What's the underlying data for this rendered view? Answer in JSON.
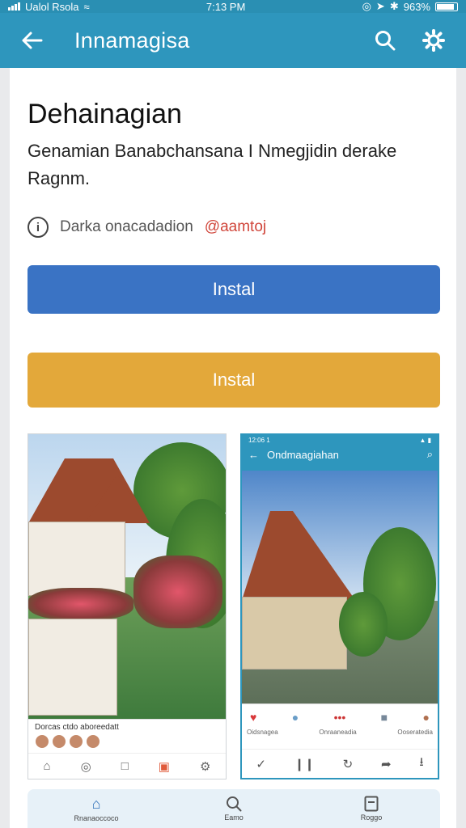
{
  "status_bar": {
    "carrier": "Ualol Rsola",
    "time": "7:13 PM",
    "battery": "963%"
  },
  "app_bar": {
    "title": "Innamagisa"
  },
  "content": {
    "heading": "Dehainagian",
    "description": "Genamian Banabchansana I Nmegjidin derake Ragnm.",
    "info_text": "Darka onacadadion",
    "info_link": "@aamtoj",
    "primary_button": "Instal",
    "secondary_button": "Instal"
  },
  "screenshot_left": {
    "caption": "Dorcas ctdo aboreedatt"
  },
  "screenshot_right": {
    "status_time": "12:06 1",
    "title": "Ondmaagiahan",
    "social_labels": [
      "Oidsnagea",
      "Onraaneadia",
      "Ooseratedia"
    ]
  },
  "bottom_nav": {
    "items": [
      {
        "label": "Rnanaoccoco",
        "icon": "home-icon"
      },
      {
        "label": "Eamo",
        "icon": "search-icon"
      },
      {
        "label": "Roggo",
        "icon": "file-icon"
      }
    ]
  },
  "colors": {
    "accent": "#2e96bd",
    "primary_button": "#3a73c4",
    "secondary_button": "#e3a83a",
    "link": "#d0453a"
  }
}
